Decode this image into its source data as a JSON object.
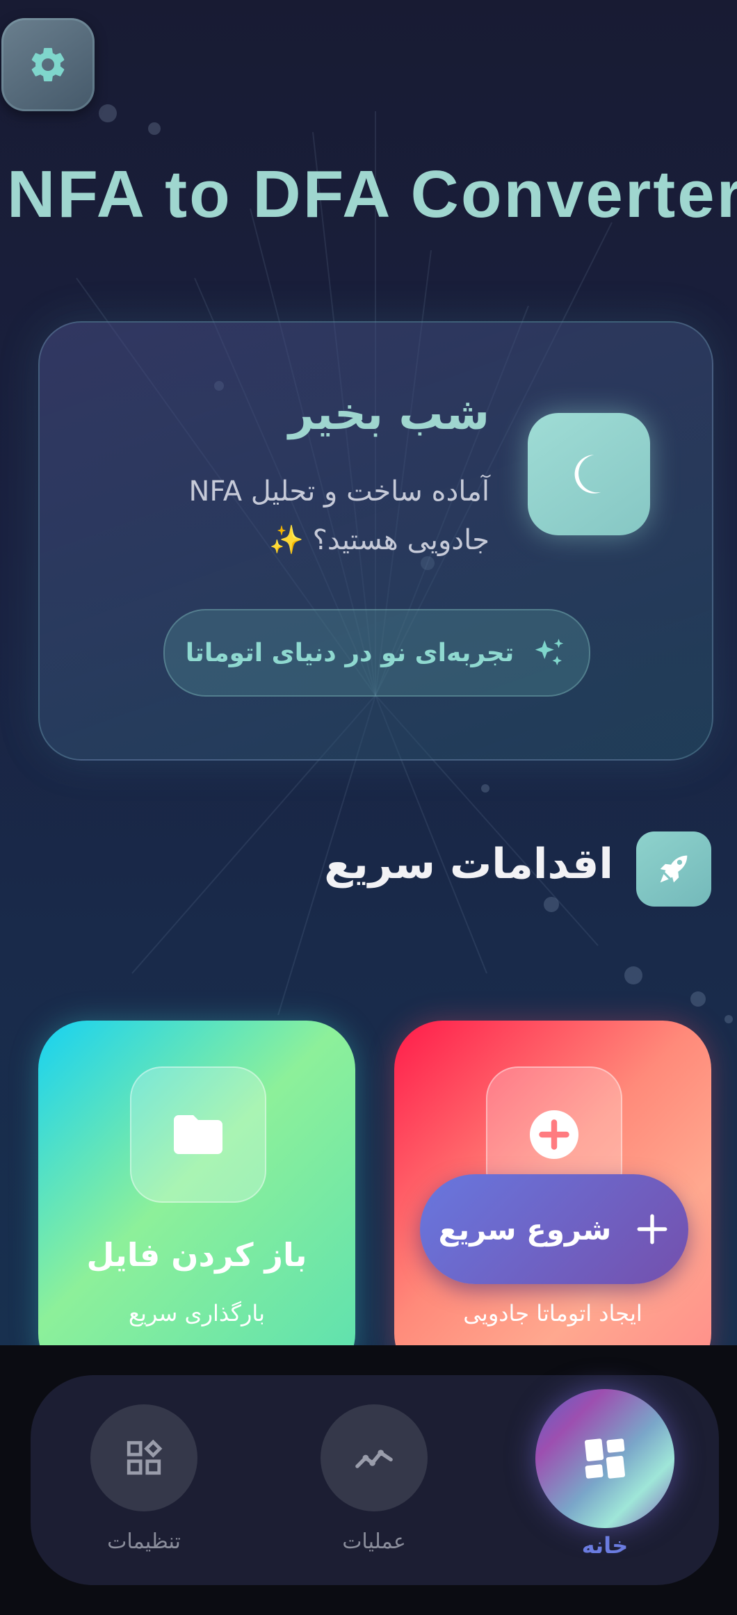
{
  "app": {
    "title": "NFA to DFA Converter"
  },
  "welcome": {
    "greeting": "شب بخیر",
    "subtitle": "آماده ساخت و تحلیل NFA جادویی هستید؟ ✨",
    "pill_label": "تجربه‌ای نو در دنیای اتوماتا"
  },
  "quick_actions": {
    "title": "اقدامات سریع",
    "cards": [
      {
        "title": "باز کردن فایل",
        "subtitle": "بارگذاری سریع",
        "icon": "folder-icon"
      },
      {
        "title": "",
        "subtitle": "ایجاد اتوماتا جادویی",
        "icon": "plus-circle-icon"
      }
    ]
  },
  "fab": {
    "label": "شروع سریع",
    "icon": "plus-icon"
  },
  "nav": {
    "items": [
      {
        "label": "تنظیمات",
        "icon": "widgets-icon"
      },
      {
        "label": "عملیات",
        "icon": "chart-line-icon"
      },
      {
        "label": "خانه",
        "icon": "dashboard-icon"
      }
    ],
    "active": "خانه"
  },
  "colors": {
    "accent_teal": "#9fd6cf",
    "nav_active": "#6b7ce0",
    "card_open": "#8df09a",
    "card_create": "#ff6f6f",
    "fab": "#6c6ad0"
  }
}
